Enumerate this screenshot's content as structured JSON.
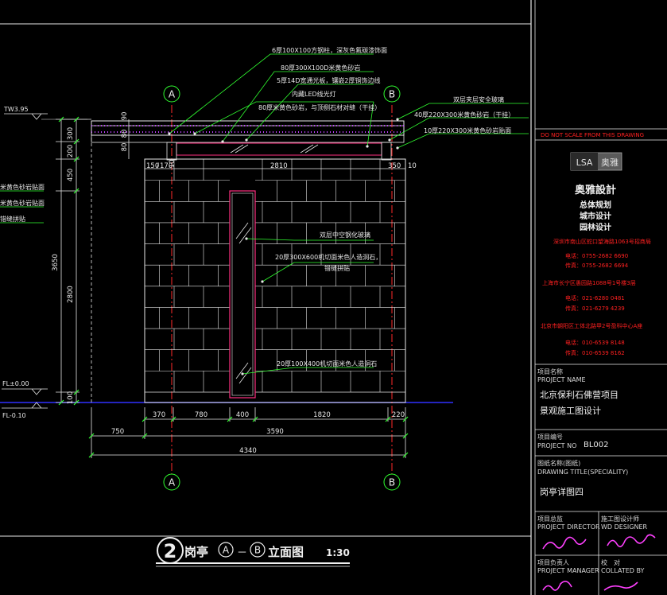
{
  "drawing": {
    "grid_labels": {
      "left": "A",
      "right": "B"
    },
    "levels": {
      "top": "TW3.95",
      "floor": "FL±0.00",
      "ground": "FL-0.10"
    },
    "annotations": {
      "a1": "6厚100X100方钢柱，深灰色氟碳漆饰面",
      "a2": "80厚300X100D米黄色砂岩",
      "a3": "5厚14D宽通光板，镶嵌2厚铜饰边线",
      "a4": "内藏LED线光灯",
      "a5": "80厚米黄色砂岩，与顶侧石材对缝（干挂）",
      "a6": "双层夹层安全玻璃",
      "a7": "40厚220X300米黄色砂岩（干挂）",
      "a8": "10厚220X300米黄色砂岩贴面",
      "a9": "双层中空钢化玻璃",
      "a10": "20厚300X600机切面米色人造洞石，",
      "a10b": "错缝拼贴",
      "a11": "20厚100X400机切面米色人造洞石",
      "left1": "米黄色砂岩贴面",
      "left2": "米黄色砂岩贴面",
      "left3": "错缝拼贴"
    },
    "dims": {
      "v300": "300",
      "v200": "200",
      "v450": "450",
      "v3650": "3650",
      "v2800": "2800",
      "v100": "100",
      "s90": "90",
      "s80": "80",
      "s10": "10",
      "w150": "150",
      "w170": "170",
      "w2810": "2810",
      "w350": "350",
      "w10r": "10",
      "b370": "370",
      "b780": "780",
      "b400": "400",
      "b1820": "1820",
      "b220": "220",
      "o750": "750",
      "o3590": "3590",
      "total": "4340"
    },
    "title": {
      "num": "2",
      "pre": "岗亭",
      "a": "A",
      "dash": "－",
      "b": "B",
      "post": "立面图",
      "scale": "1:30"
    }
  },
  "titleblock": {
    "top_red": "DO NOT SCALE FROM THIS DRAWING",
    "logo_text": "LSA",
    "logo_brand": "奥雅",
    "company": "奥雅設計",
    "services": [
      "总体规划",
      "城市设计",
      "园林设计"
    ],
    "offices": [
      {
        "addr": "深圳市南山区蛇口望海路1063号招商局",
        "tel": "电话：0755-2682 6690",
        "fax": "传真：0755-2682 6694"
      },
      {
        "addr": "上海市长宁区愚园路1088号1号楼3层",
        "tel": "电话：021-6280 0481",
        "fax": "传真：021-6279 4239"
      },
      {
        "addr": "北京市朝阳区工体北路甲2号盈科中心A座",
        "tel": "电话：010-6539 8148",
        "fax": "传真：010-6539 8162"
      }
    ],
    "project_name_cn": "项目名称",
    "project_name_en": "PROJECT NAME",
    "project_line1": "北京保利石佛营项目",
    "project_line2": "景观施工图设计",
    "project_no_cn": "项目编号",
    "project_no_en": "PROJECT NO",
    "project_no": "BL002",
    "drawing_title_cn": "图纸名称(图纸)",
    "drawing_title_en": "DRAWING TITLE(SPECIALITY)",
    "drawing_title": "岗亭详图四",
    "director_cn": "项目总监",
    "director_en": "PROJECT DIRECTOR",
    "designer_cn": "施工图设计师",
    "designer_en": "WD DESIGNER",
    "manager_cn": "项目负责人",
    "manager_en": "PROJECT MANAGER",
    "checker_cn": "校　对",
    "checker_en": "COLLATED BY"
  }
}
